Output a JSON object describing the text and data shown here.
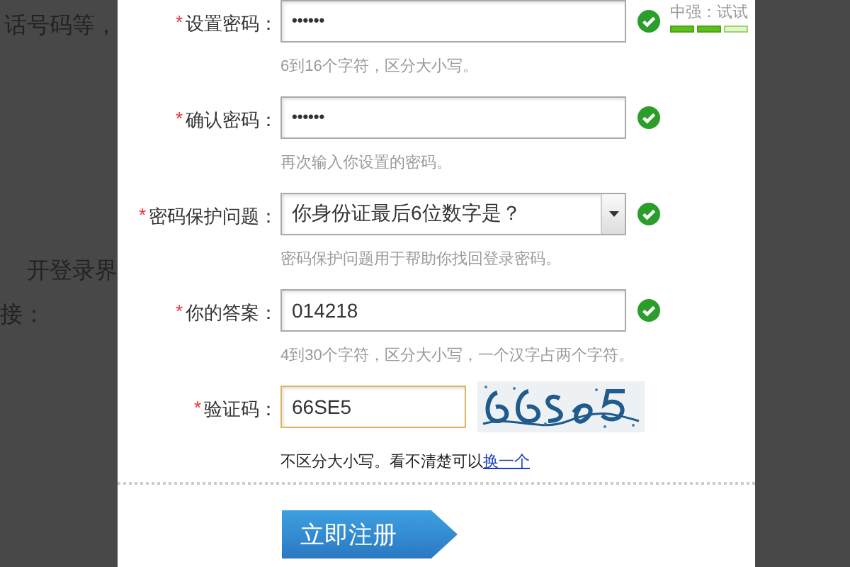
{
  "background": {
    "texts": [
      "话号码等，",
      "开登录界",
      "接："
    ]
  },
  "form": {
    "rows": [
      {
        "kind": "password",
        "mark": "*",
        "label": "设置密码：",
        "value": "••••••",
        "valid": true,
        "hint": "6到16个字符，区分大小写。",
        "strength": {
          "label": "中强：试试",
          "level": 0.67
        }
      },
      {
        "kind": "password",
        "mark": "*",
        "label": "确认密码：",
        "value": "••••••",
        "valid": true,
        "hint": "再次输入你设置的密码。"
      },
      {
        "kind": "select",
        "mark": "*",
        "label": "密码保护问题：",
        "value": "你身份证最后6位数字是？",
        "valid": true,
        "hint": "密码保护问题用于帮助你找回登录密码。"
      },
      {
        "kind": "text",
        "mark": "*",
        "label": "你的答案：",
        "value": "014218",
        "valid": true,
        "hint": "4到30个字符，区分大小写，一个汉字占两个字符。"
      },
      {
        "kind": "captcha",
        "mark": "*",
        "label": "验证码：",
        "value": "66SE5",
        "focused": true,
        "note": "不区分大小写。看不清楚可以",
        "link": "换一个"
      }
    ],
    "submit": "立即注册"
  }
}
